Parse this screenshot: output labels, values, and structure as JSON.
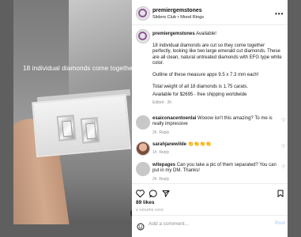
{
  "media": {
    "overlay_text": "18 individual diamonds come together",
    "mute_icon": "speaker-muted-icon"
  },
  "header": {
    "username": "premiergemstones",
    "subtitle": "Sliders Club • Mood Rings",
    "more_icon": "more-dots-icon"
  },
  "caption": {
    "username": "premiergemstones",
    "lead": "Available!",
    "para1": "18 individual diamonds are cut so they come together perfectly, looking like two large emerald cut diamonds. These are all clean, natural untreated diamonds with EFG type white color.",
    "para2": "Outline of these measure appx 9.5 x 7.3 mm each!",
    "para3": "Total weight of all 18 diamonds is 1.75 carats.",
    "para4": "Available for $2695 - free shipping worldwide",
    "edited": "Edited · 2h"
  },
  "comments": [
    {
      "username": "esaiconacentoenlai",
      "text": "Wooow isn't this amazing? To me is really impressive",
      "time": "2h",
      "reply": "Reply"
    },
    {
      "username": "sarahjanewilde",
      "text": "👏👏👏👏",
      "time": "1h",
      "reply": "Reply"
    },
    {
      "username": "witepages",
      "text": "Can you take a pic of them separated? You can put in my DM. Thanks!",
      "time": "2h",
      "reply": "Reply"
    }
  ],
  "actions": {
    "like_icon": "heart-icon",
    "comment_icon": "comment-icon",
    "share_icon": "paper-plane-icon",
    "save_icon": "bookmark-icon"
  },
  "likes": "89 likes",
  "posted": "2 HOURS AGO",
  "add_comment": {
    "placeholder": "Add a comment...",
    "post_label": "Post",
    "emoji_icon": "smiley-icon"
  },
  "colors": {
    "link_blue": "#0095f6",
    "post_disabled": "#b7d5f7",
    "meta_gray": "#8e8e8e"
  }
}
